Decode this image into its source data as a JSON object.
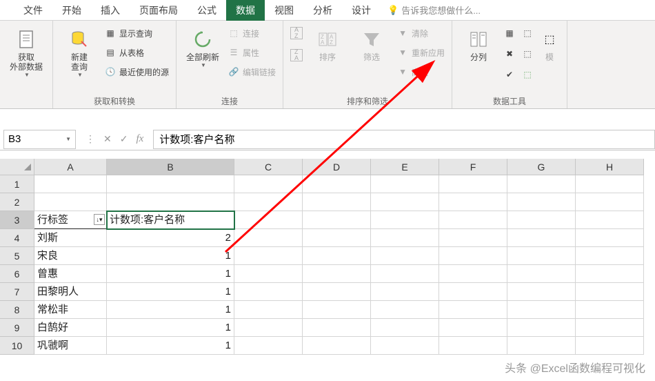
{
  "menubar": {
    "tabs": [
      "文件",
      "开始",
      "插入",
      "页面布局",
      "公式",
      "数据",
      "视图",
      "分析",
      "设计"
    ],
    "active_index": 5,
    "tell_me": "告诉我您想做什么..."
  },
  "ribbon": {
    "groups": [
      {
        "label": "",
        "big": [
          {
            "label": "获取\n外部数据",
            "icon": "file-icon"
          }
        ]
      },
      {
        "label": "获取和转换",
        "big": [
          {
            "label": "新建\n查询",
            "icon": "db-icon"
          }
        ],
        "small": [
          {
            "label": "显示查询",
            "icon": "grid-icon"
          },
          {
            "label": "从表格",
            "icon": "table-icon"
          },
          {
            "label": "最近使用的源",
            "icon": "recent-icon"
          }
        ]
      },
      {
        "label": "连接",
        "big": [
          {
            "label": "全部刷新",
            "icon": "refresh-icon"
          }
        ],
        "small": [
          {
            "label": "连接",
            "icon": "link-icon",
            "disabled": true
          },
          {
            "label": "属性",
            "icon": "props-icon",
            "disabled": true
          },
          {
            "label": "编辑链接",
            "icon": "edit-link-icon",
            "disabled": true
          }
        ]
      },
      {
        "label": "排序和筛选",
        "big": [
          {
            "label": "排序",
            "icon": "sort-icon",
            "disabled": true
          },
          {
            "label": "筛选",
            "icon": "filter-icon",
            "disabled": true
          }
        ],
        "sort_small": [
          {
            "icon": "az-icon",
            "disabled": true
          },
          {
            "icon": "za-icon",
            "disabled": true
          }
        ],
        "small": [
          {
            "label": "清除",
            "icon": "clear-icon",
            "disabled": true
          },
          {
            "label": "重新应用",
            "icon": "reapply-icon",
            "disabled": true
          },
          {
            "label": "高级",
            "icon": "advanced-icon",
            "disabled": true
          }
        ]
      },
      {
        "label": "数据工具",
        "big": [
          {
            "label": "分列",
            "icon": "split-icon"
          }
        ]
      }
    ]
  },
  "formula_bar": {
    "name_box": "B3",
    "formula": "计数项:客户名称"
  },
  "grid": {
    "columns": [
      "A",
      "B",
      "C",
      "D",
      "E",
      "F",
      "G",
      "H"
    ],
    "active_col": 1,
    "active_row": 3,
    "header_row": {
      "row": 3,
      "a": "行标签",
      "b": "计数项:客户名称"
    },
    "rows": [
      {
        "row": 4,
        "a": "刘斯",
        "b": 2
      },
      {
        "row": 5,
        "a": "宋良",
        "b": 1
      },
      {
        "row": 6,
        "a": "曾惠",
        "b": 1
      },
      {
        "row": 7,
        "a": "田黎明人",
        "b": 1
      },
      {
        "row": 8,
        "a": "常松非",
        "b": 1
      },
      {
        "row": 9,
        "a": "白鹄好",
        "b": 1
      },
      {
        "row": 10,
        "a": "巩虢啊",
        "b": 1
      }
    ]
  },
  "watermark": "头条 @Excel函数编程可视化"
}
